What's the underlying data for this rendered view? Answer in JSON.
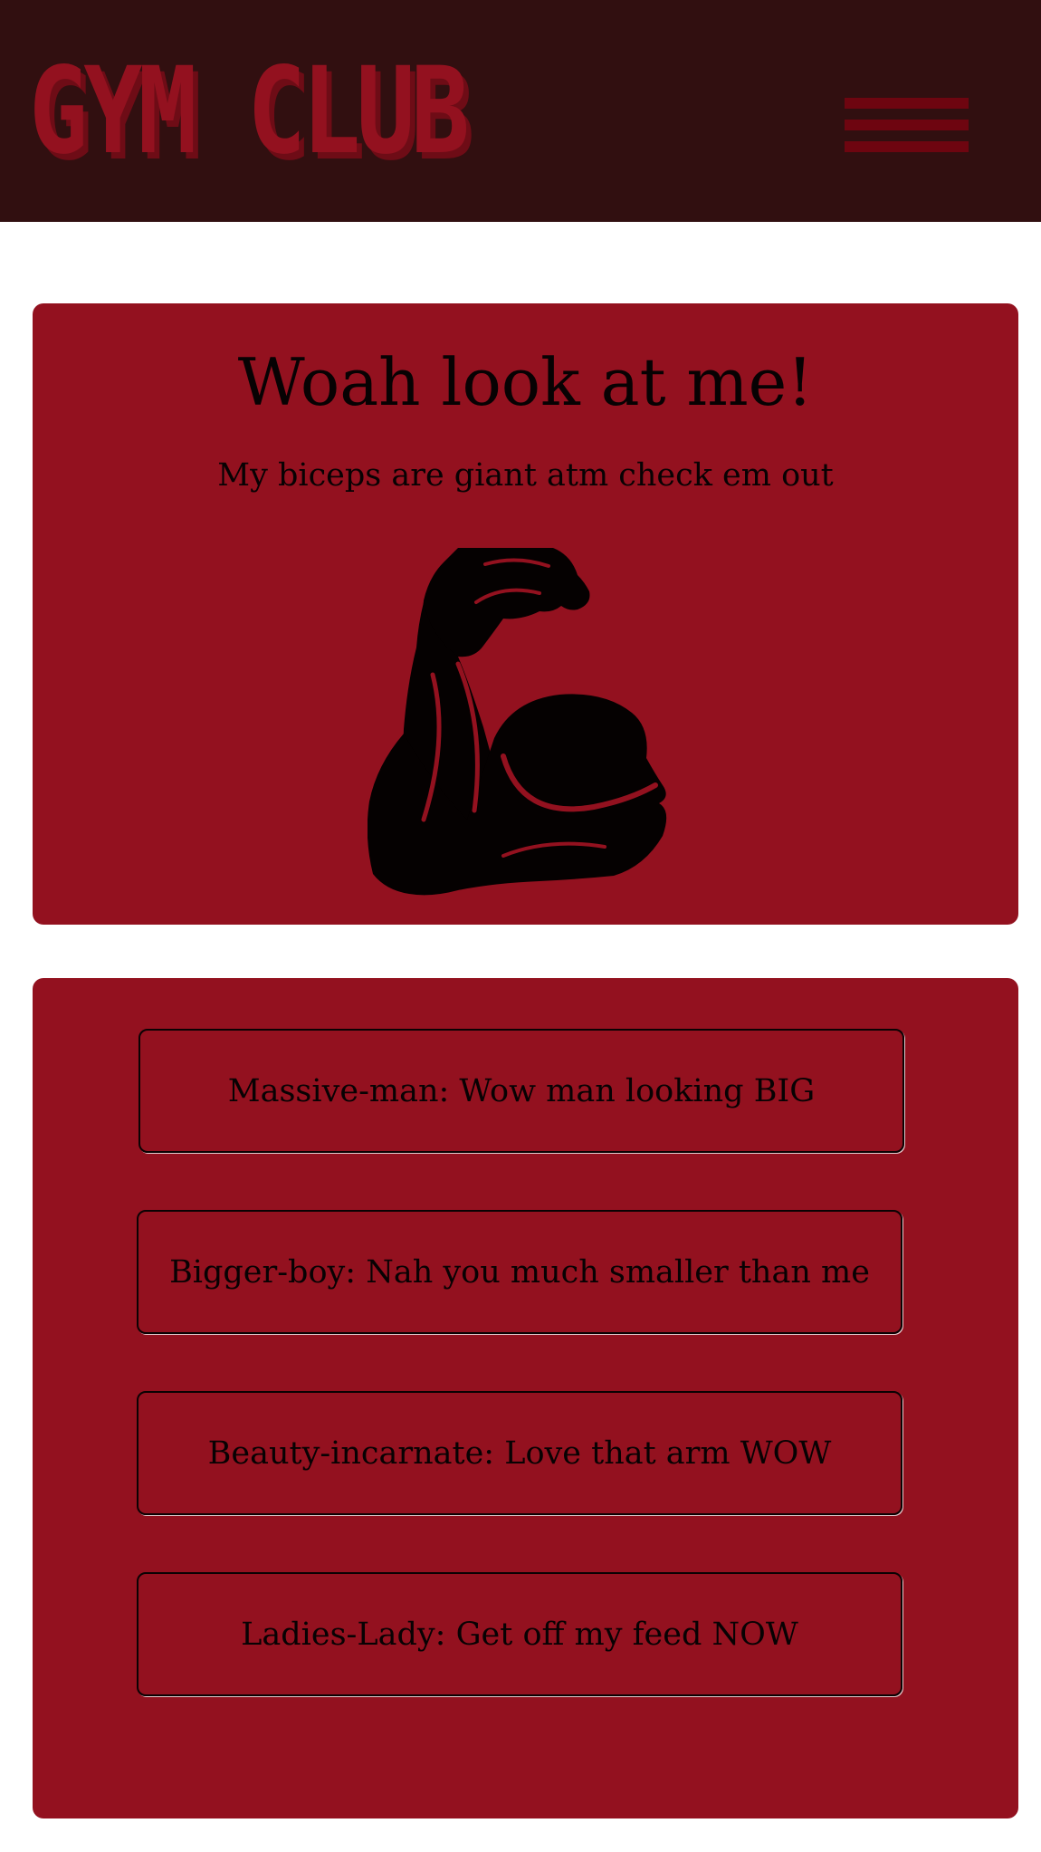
{
  "header": {
    "logo_text": "GYM CLUB",
    "background_color": "#310f10",
    "accent_color": "#93111f",
    "menu_icon": "hamburger-menu-icon"
  },
  "post": {
    "title": "Woah look at me!",
    "subtitle": "My biceps are giant atm check em out",
    "image_icon": "flexed-biceps-icon",
    "card_color": "#93111f"
  },
  "comments": [
    {
      "text": "Massive-man: Wow man looking BIG"
    },
    {
      "text": "Bigger-boy: Nah you much smaller than me"
    },
    {
      "text": "Beauty-incarnate: Love that arm WOW"
    },
    {
      "text": "Ladies-Lady: Get off my feed NOW"
    }
  ]
}
